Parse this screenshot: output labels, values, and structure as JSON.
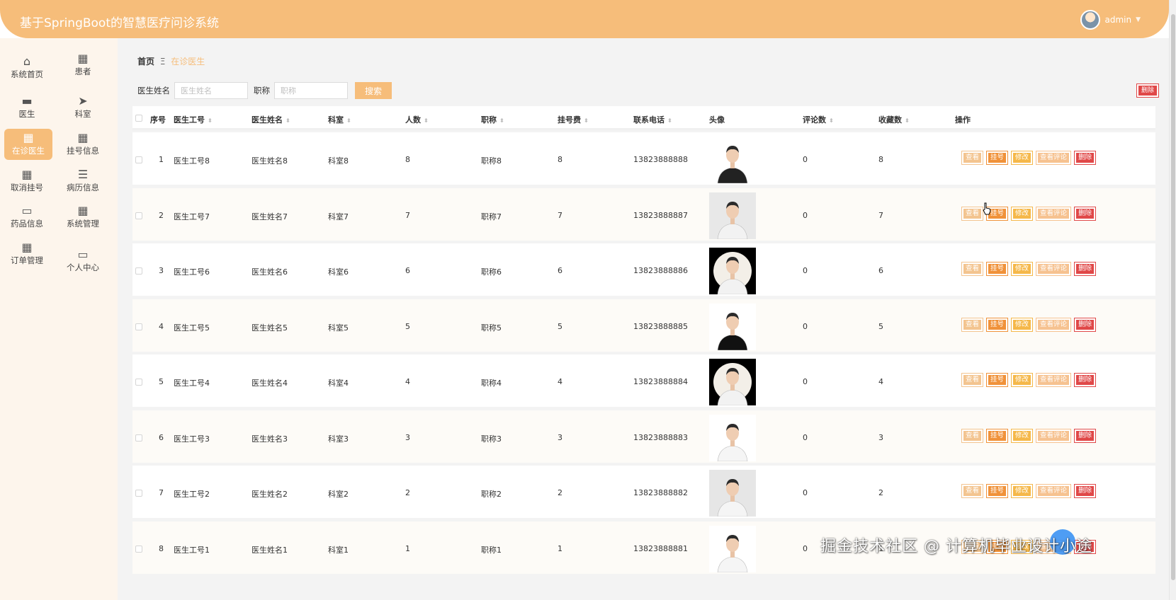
{
  "header": {
    "title": "基于SpringBoot的智慧医疗问诊系统",
    "username": "admin"
  },
  "sidebar": {
    "items": [
      {
        "label": "系统首页",
        "icon": "home-icon"
      },
      {
        "label": "患者",
        "icon": "grid-icon"
      },
      {
        "label": "医生",
        "icon": "chat-icon"
      },
      {
        "label": "科室",
        "icon": "send-icon"
      },
      {
        "label": "在诊医生",
        "icon": "grid-icon",
        "active": true
      },
      {
        "label": "挂号信息",
        "icon": "grid-icon"
      },
      {
        "label": "取消挂号",
        "icon": "grid-icon"
      },
      {
        "label": "病历信息",
        "icon": "list-icon"
      },
      {
        "label": "药品信息",
        "icon": "monitor-icon"
      },
      {
        "label": "系统管理",
        "icon": "grid-icon"
      },
      {
        "label": "订单管理",
        "icon": "apps-icon"
      },
      {
        "label": "个人中心",
        "icon": "card-icon"
      }
    ]
  },
  "breadcrumb": {
    "home": "首页",
    "separator": "Ξ",
    "current": "在诊医生"
  },
  "search": {
    "name_label": "医生姓名",
    "name_placeholder": "医生姓名",
    "title_label": "职称",
    "title_placeholder": "职称",
    "button": "搜索"
  },
  "toolbar": {
    "delete_label": "删除"
  },
  "table": {
    "headers": {
      "index": "序号",
      "doctor_no": "医生工号",
      "doctor_name": "医生姓名",
      "department": "科室",
      "count": "人数",
      "title": "职称",
      "fee": "挂号费",
      "phone": "联系电话",
      "avatar": "头像",
      "comments": "评论数",
      "favorites": "收藏数",
      "actions": "操作"
    },
    "action_labels": {
      "view": "查看",
      "register": "挂号",
      "edit": "修改",
      "reviews": "查看评论",
      "delete": "删除"
    },
    "rows": [
      {
        "index": "1",
        "doctor_no": "医生工号8",
        "doctor_name": "医生姓名8",
        "department": "科室8",
        "count": "8",
        "title": "职称8",
        "fee": "8",
        "phone": "13823888888",
        "comments": "0",
        "favorites": "8"
      },
      {
        "index": "2",
        "doctor_no": "医生工号7",
        "doctor_name": "医生姓名7",
        "department": "科室7",
        "count": "7",
        "title": "职称7",
        "fee": "7",
        "phone": "13823888887",
        "comments": "0",
        "favorites": "7"
      },
      {
        "index": "3",
        "doctor_no": "医生工号6",
        "doctor_name": "医生姓名6",
        "department": "科室6",
        "count": "6",
        "title": "职称6",
        "fee": "6",
        "phone": "13823888886",
        "comments": "0",
        "favorites": "6"
      },
      {
        "index": "4",
        "doctor_no": "医生工号5",
        "doctor_name": "医生姓名5",
        "department": "科室5",
        "count": "5",
        "title": "职称5",
        "fee": "5",
        "phone": "13823888885",
        "comments": "0",
        "favorites": "5"
      },
      {
        "index": "5",
        "doctor_no": "医生工号4",
        "doctor_name": "医生姓名4",
        "department": "科室4",
        "count": "4",
        "title": "职称4",
        "fee": "4",
        "phone": "13823888884",
        "comments": "0",
        "favorites": "4"
      },
      {
        "index": "6",
        "doctor_no": "医生工号3",
        "doctor_name": "医生姓名3",
        "department": "科室3",
        "count": "3",
        "title": "职称3",
        "fee": "3",
        "phone": "13823888883",
        "comments": "0",
        "favorites": "3"
      },
      {
        "index": "7",
        "doctor_no": "医生工号2",
        "doctor_name": "医生姓名2",
        "department": "科室2",
        "count": "2",
        "title": "职称2",
        "fee": "2",
        "phone": "13823888882",
        "comments": "0",
        "favorites": "2"
      },
      {
        "index": "8",
        "doctor_no": "医生工号1",
        "doctor_name": "医生姓名1",
        "department": "科室1",
        "count": "1",
        "title": "职称1",
        "fee": "1",
        "phone": "13823888881",
        "comments": "0",
        "favorites": "1"
      }
    ]
  },
  "watermark": "掘金技术社区 @ 计算机毕业设计小途",
  "colors": {
    "accent": "#f6bd7a",
    "danger": "#e04848",
    "sidebar_bg": "#fdf5ec"
  }
}
